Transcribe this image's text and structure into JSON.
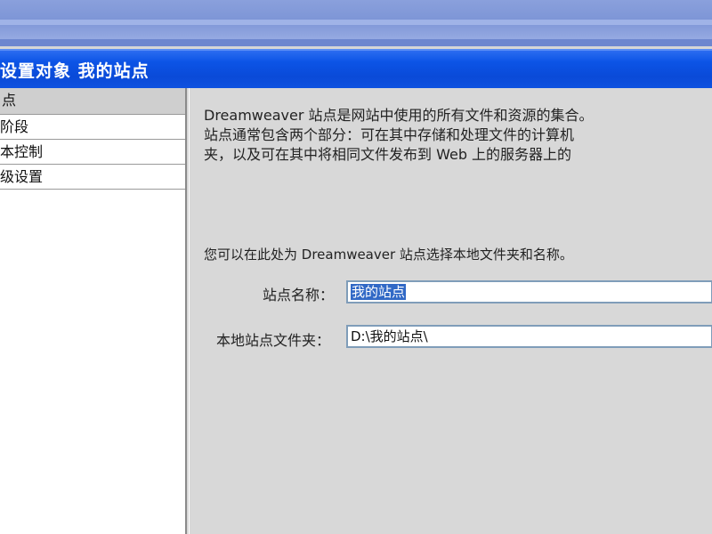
{
  "colors": {
    "titlebar": "#0a4ad8",
    "selection": "#3169c6",
    "panel": "#d8d8d8"
  },
  "dialog": {
    "title": "设置对象 我的站点"
  },
  "categories": {
    "header": "点",
    "items": [
      "阶段",
      "本控制",
      "级设置"
    ]
  },
  "settings": {
    "description": "Dreamweaver 站点是网站中使用的所有文件和资源的集合。\n站点通常包含两个部分：可在其中存储和处理文件的计算机\n夹，以及可在其中将相同文件发布到 Web 上的服务器上的",
    "hint": "您可以在此处为 Dreamweaver 站点选择本地文件夹和名称。",
    "site_name": {
      "label": "站点名称：",
      "value": "我的站点"
    },
    "local_folder": {
      "label": "本地站点文件夹：",
      "value": "D:\\我的站点\\"
    }
  }
}
